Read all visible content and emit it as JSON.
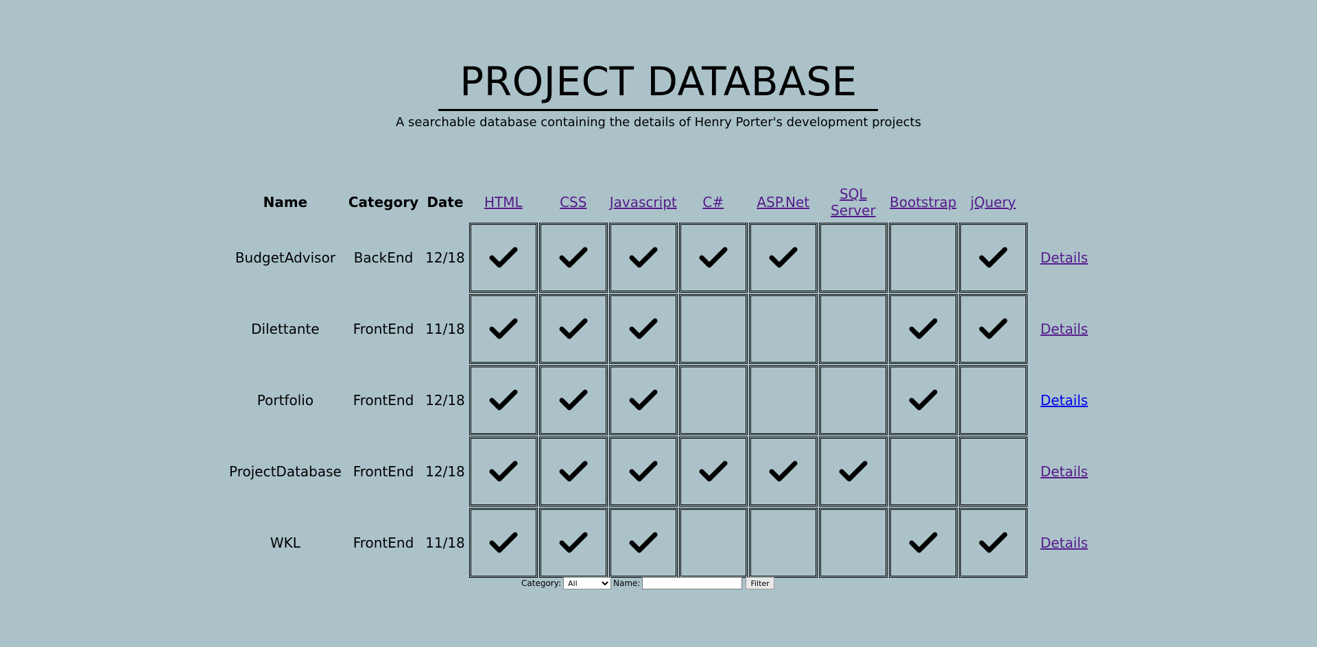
{
  "header": {
    "title": "PROJECT DATABASE",
    "subtitle": "A searchable database containing the details of Henry Porter's development projects"
  },
  "table": {
    "columns": {
      "name": "Name",
      "category": "Category",
      "date": "Date",
      "skills": [
        "HTML",
        "CSS",
        "Javascript",
        "C#",
        "ASP.Net",
        "SQL Server",
        "Bootstrap",
        "jQuery"
      ]
    },
    "details_label": "Details",
    "rows": [
      {
        "name": "BudgetAdvisor",
        "category": "BackEnd",
        "date": "12/18",
        "skills": [
          true,
          true,
          true,
          true,
          true,
          false,
          false,
          true
        ]
      },
      {
        "name": "Dilettante",
        "category": "FrontEnd",
        "date": "11/18",
        "skills": [
          true,
          true,
          true,
          false,
          false,
          false,
          true,
          true
        ]
      },
      {
        "name": "Portfolio",
        "category": "FrontEnd",
        "date": "12/18",
        "skills": [
          true,
          true,
          true,
          false,
          false,
          false,
          true,
          false
        ]
      },
      {
        "name": "ProjectDatabase",
        "category": "FrontEnd",
        "date": "12/18",
        "skills": [
          true,
          true,
          true,
          true,
          true,
          true,
          false,
          false
        ]
      },
      {
        "name": "WKL",
        "category": "FrontEnd",
        "date": "11/18",
        "skills": [
          true,
          true,
          true,
          false,
          false,
          false,
          true,
          true
        ]
      }
    ]
  },
  "filter": {
    "category_label": "Category:",
    "category_selected": "All",
    "name_label": "Name:",
    "name_value": "",
    "button_label": "Filter"
  },
  "colors": {
    "background": "#abc2c9",
    "visited_link": "#551a8b",
    "link": "#0000ee"
  }
}
